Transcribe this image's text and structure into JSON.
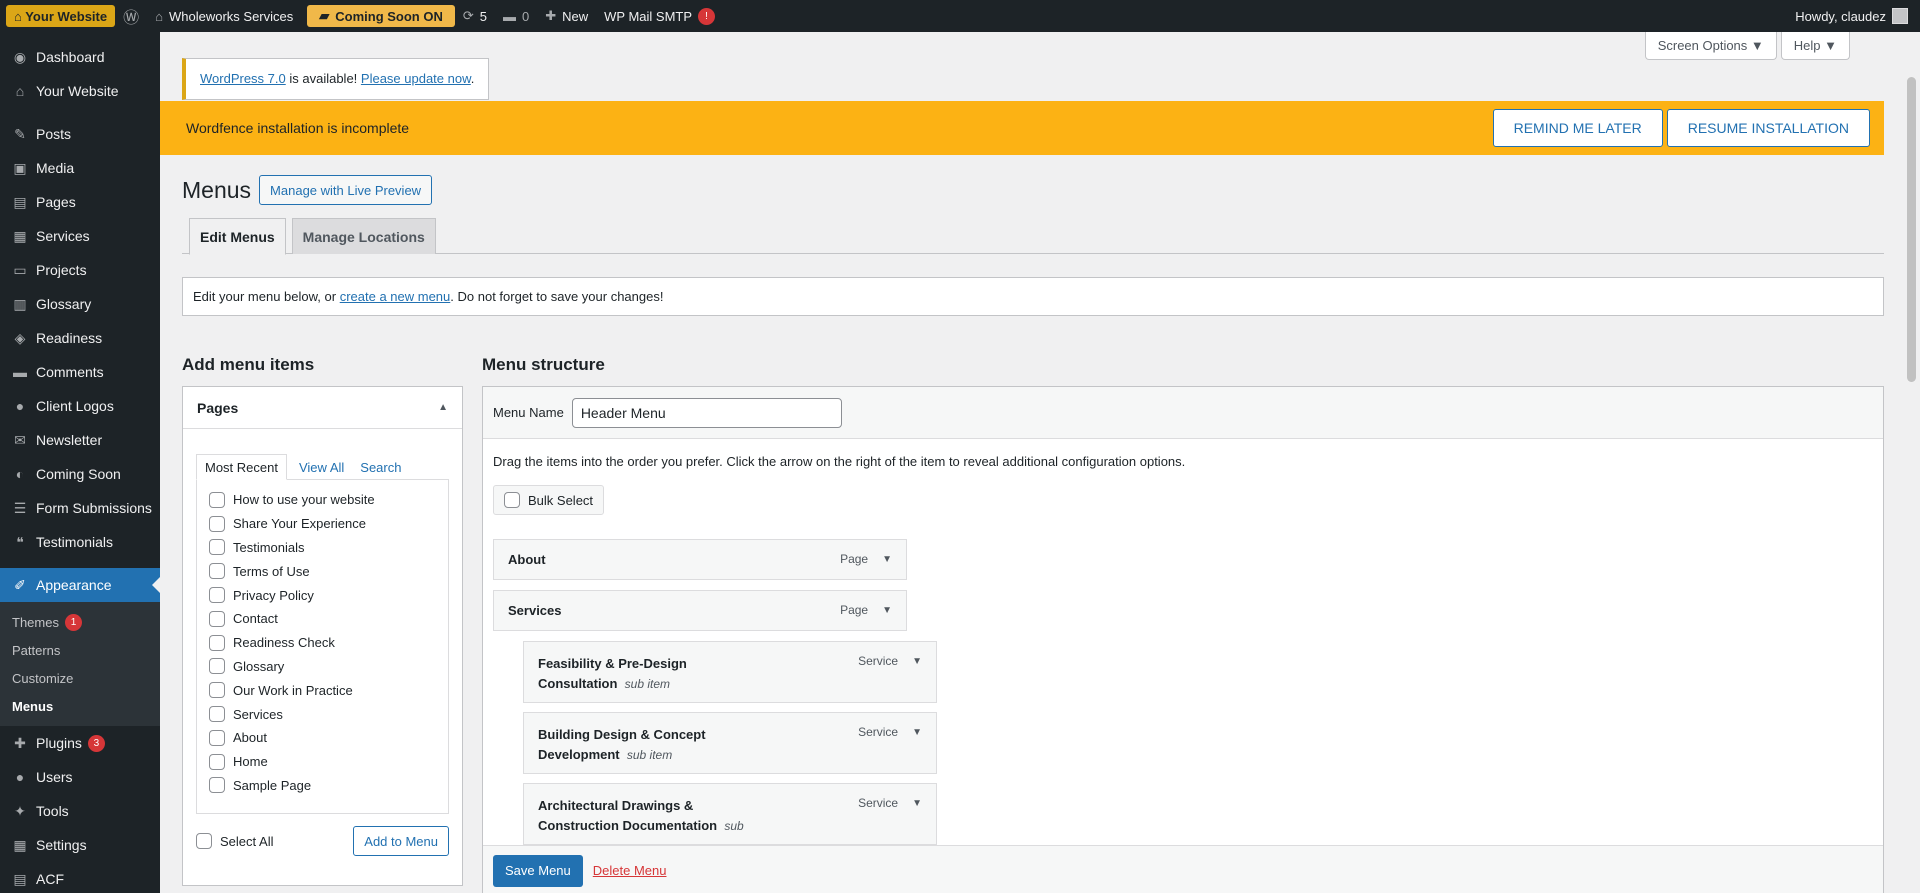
{
  "adminbar": {
    "your_website": "⌂ Your Website",
    "site_name": "Wholeworks Services",
    "coming_soon": "Coming Soon ON",
    "updates_count": "5",
    "comments_count": "0",
    "new_label": "New",
    "wp_mail_smtp": "WP Mail SMTP",
    "smtp_alert": "!",
    "howdy": "Howdy, claudez"
  },
  "sidebar": {
    "items": [
      {
        "label": "Dashboard",
        "icon": "dashboard-icon",
        "glyph": "◉"
      },
      {
        "label": "Your Website",
        "icon": "home-icon",
        "glyph": "⌂"
      },
      {
        "label": "Posts",
        "icon": "pin-icon",
        "glyph": "✎"
      },
      {
        "label": "Media",
        "icon": "media-icon",
        "glyph": "▣"
      },
      {
        "label": "Pages",
        "icon": "pages-icon",
        "glyph": "▤"
      },
      {
        "label": "Services",
        "icon": "grid-icon",
        "glyph": "▦"
      },
      {
        "label": "Projects",
        "icon": "folder-icon",
        "glyph": "▭"
      },
      {
        "label": "Glossary",
        "icon": "book-icon",
        "glyph": "▥"
      },
      {
        "label": "Readiness",
        "icon": "tag-icon",
        "glyph": "◈"
      },
      {
        "label": "Comments",
        "icon": "comment-icon",
        "glyph": "▬"
      },
      {
        "label": "Client Logos",
        "icon": "user-icon",
        "glyph": "●"
      },
      {
        "label": "Newsletter",
        "icon": "mail-icon",
        "glyph": "✉"
      },
      {
        "label": "Coming Soon",
        "icon": "megaphone-icon",
        "glyph": "◐"
      },
      {
        "label": "Form Submissions",
        "icon": "list-icon",
        "glyph": "☰"
      },
      {
        "label": "Testimonials",
        "icon": "quote-icon",
        "glyph": "❝"
      },
      {
        "label": "Appearance",
        "icon": "brush-icon",
        "glyph": "✐"
      }
    ],
    "submenu": [
      {
        "label": "Themes",
        "badge": "1"
      },
      {
        "label": "Patterns"
      },
      {
        "label": "Customize"
      },
      {
        "label": "Menus"
      }
    ],
    "bottom_items": [
      {
        "label": "Plugins",
        "icon": "plugin-icon",
        "glyph": "✚",
        "badge": "3"
      },
      {
        "label": "Users",
        "icon": "users-icon",
        "glyph": "●"
      },
      {
        "label": "Tools",
        "icon": "wrench-icon",
        "glyph": "✦"
      },
      {
        "label": "Settings",
        "icon": "settings-icon",
        "glyph": "▦"
      },
      {
        "label": "ACF",
        "icon": "acf-icon",
        "glyph": "▤"
      }
    ]
  },
  "screen_options": "Screen Options ▼",
  "help": "Help ▼",
  "update_nag": {
    "link1": "WordPress 7.0",
    "text1": " is available! ",
    "link2": "Please update now",
    "text2": "."
  },
  "wordfence": {
    "message": "Wordfence installation is incomplete",
    "remind": "REMIND ME LATER",
    "resume": "RESUME INSTALLATION"
  },
  "page": {
    "title": "Menus",
    "live_preview": "Manage with Live Preview",
    "tabs": [
      "Edit Menus",
      "Manage Locations"
    ],
    "manage_text1": "Edit your menu below, or ",
    "manage_link": "create a new menu",
    "manage_text2": ". Do not forget to save your changes!"
  },
  "add_items": {
    "heading": "Add menu items",
    "panel_title": "Pages",
    "tabs": [
      "Most Recent",
      "View All",
      "Search"
    ],
    "pages": [
      "How to use your website",
      "Share Your Experience",
      "Testimonials",
      "Terms of Use",
      "Privacy Policy",
      "Contact",
      "Readiness Check",
      "Glossary",
      "Our Work in Practice",
      "Services",
      "About",
      "Home",
      "Sample Page"
    ],
    "select_all": "Select All",
    "add_button": "Add to Menu"
  },
  "structure": {
    "heading": "Menu structure",
    "menu_name_label": "Menu Name",
    "menu_name_value": "Header Menu",
    "drag_desc": "Drag the items into the order you prefer. Click the arrow on the right of the item to reveal additional configuration options.",
    "bulk_select": "Bulk Select",
    "items": [
      {
        "title": "About",
        "type": "Page",
        "sub": ""
      },
      {
        "title": "Services",
        "type": "Page",
        "sub": ""
      },
      {
        "title": "Feasibility & Pre-Design",
        "title2": "Consultation",
        "type": "Service",
        "sub": "sub item"
      },
      {
        "title": "Building Design & Concept",
        "title2": "Development",
        "type": "Service",
        "sub": "sub item"
      },
      {
        "title": "Architectural Drawings &",
        "title2": "Construction Documentation",
        "type": "Service",
        "sub": "sub"
      }
    ],
    "save": "Save Menu",
    "delete": "Delete Menu"
  }
}
